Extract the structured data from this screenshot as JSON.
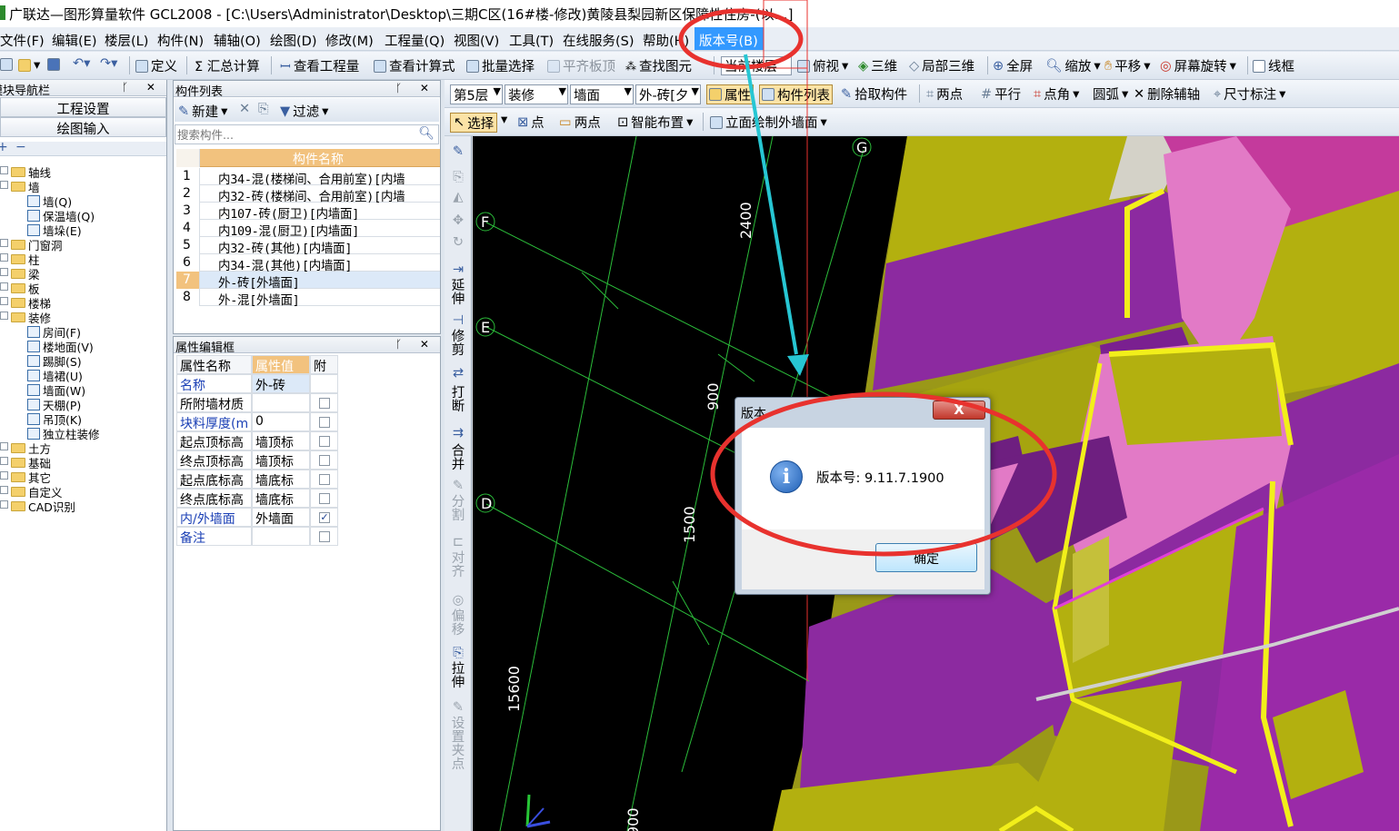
{
  "window": {
    "title": "广联达—图形算量软件 GCL2008 - [C:\\Users\\Administrator\\Desktop\\三期C区(16#楼-修改)黄陵县梨园新区保障性住房-(以…]"
  },
  "menu": {
    "items": [
      "文件(F)",
      "编辑(E)",
      "楼层(L)",
      "构件(N)",
      "辅轴(O)",
      "绘图(D)",
      "修改(M)",
      "工程量(Q)",
      "视图(V)",
      "工具(T)",
      "在线服务(S)",
      "帮助(H)"
    ],
    "version": "版本号(B)"
  },
  "toolbar1": {
    "define": "定义",
    "summary": "Σ 汇总计算",
    "view_qty": "查看工程量",
    "view_formula": "查看计算式",
    "batch_select": "批量选择",
    "flat_slab": "平齐板顶",
    "find_elem": "查找图元",
    "floor_combo": "当前楼层",
    "top_view": "俯视",
    "three_d": "三维",
    "local_3d": "局部三维",
    "fullscreen": "全屏",
    "zoom": "缩放",
    "pan": "平移",
    "rotate": "屏幕旋转",
    "wireframe": "线框"
  },
  "toolbar2": {
    "floor": "第5层",
    "category": "装修",
    "type": "墙面",
    "component": "外-砖[夕",
    "attr": "属性",
    "comp_list": "构件列表",
    "pick": "拾取构件",
    "two_pts": "两点",
    "parallel": "平行",
    "pt_angle": "点角",
    "arc": "圆弧",
    "del_axis": "删除辅轴",
    "dim": "尺寸标注"
  },
  "toolbar3": {
    "select": "选择",
    "point": "点",
    "two_points": "两点",
    "smart": "智能布置",
    "elevation": "立面绘制外墙面"
  },
  "nav": {
    "title": "模块导航栏",
    "project_settings": "工程设置",
    "drawing_input": "绘图输入",
    "tree": [
      {
        "label": "轴线",
        "level": 0
      },
      {
        "label": "墙",
        "level": 0
      },
      {
        "label": "墙(Q)",
        "level": 1
      },
      {
        "label": "保温墙(Q)",
        "level": 1
      },
      {
        "label": "墙垛(E)",
        "level": 1
      },
      {
        "label": "门窗洞",
        "level": 0
      },
      {
        "label": "柱",
        "level": 0
      },
      {
        "label": "梁",
        "level": 0
      },
      {
        "label": "板",
        "level": 0
      },
      {
        "label": "楼梯",
        "level": 0
      },
      {
        "label": "装修",
        "level": 0
      },
      {
        "label": "房间(F)",
        "level": 1
      },
      {
        "label": "楼地面(V)",
        "level": 1
      },
      {
        "label": "踢脚(S)",
        "level": 1
      },
      {
        "label": "墙裙(U)",
        "level": 1
      },
      {
        "label": "墙面(W)",
        "level": 1
      },
      {
        "label": "天棚(P)",
        "level": 1
      },
      {
        "label": "吊顶(K)",
        "level": 1
      },
      {
        "label": "独立柱装修",
        "level": 1
      },
      {
        "label": "土方",
        "level": 0
      },
      {
        "label": "基础",
        "level": 0
      },
      {
        "label": "其它",
        "level": 0
      },
      {
        "label": "自定义",
        "level": 0
      },
      {
        "label": "CAD识别",
        "level": 0
      }
    ]
  },
  "comp_list": {
    "title": "构件列表",
    "new": "新建",
    "filter": "过滤",
    "search_placeholder": "搜索构件...",
    "header": "构件名称",
    "rows": [
      {
        "n": "1",
        "name": "内34-混(楼梯间、合用前室)[内墙"
      },
      {
        "n": "2",
        "name": "内32-砖(楼梯间、合用前室)[内墙"
      },
      {
        "n": "3",
        "name": "内107-砖(厨卫)[内墙面]"
      },
      {
        "n": "4",
        "name": "内109-混(厨卫)[内墙面]"
      },
      {
        "n": "5",
        "name": "内32-砖(其他)[内墙面]"
      },
      {
        "n": "6",
        "name": "内34-混(其他)[内墙面]"
      },
      {
        "n": "7",
        "name": "外-砖[外墙面]"
      },
      {
        "n": "8",
        "name": "外-混[外墙面]"
      }
    ]
  },
  "props": {
    "title": "属性编辑框",
    "col_name": "属性名称",
    "col_value": "属性值",
    "col_extra": "附",
    "rows": [
      {
        "name": "名称",
        "value": "外-砖",
        "check": null,
        "blue": true
      },
      {
        "name": "所附墙材质",
        "value": "",
        "check": false,
        "blue": false
      },
      {
        "name": "块料厚度(m",
        "value": "0",
        "check": false,
        "blue": true
      },
      {
        "name": "起点顶标高",
        "value": "墙顶标",
        "check": false,
        "blue": false
      },
      {
        "name": "终点顶标高",
        "value": "墙顶标",
        "check": false,
        "blue": false
      },
      {
        "name": "起点底标高",
        "value": "墙底标",
        "check": false,
        "blue": false
      },
      {
        "name": "终点底标高",
        "value": "墙底标",
        "check": false,
        "blue": false
      },
      {
        "name": "内/外墙面",
        "value": "外墙面",
        "check": true,
        "blue": true
      },
      {
        "name": "备注",
        "value": "",
        "check": false,
        "blue": true
      }
    ]
  },
  "vtools": [
    "延伸",
    "修剪",
    "打断",
    "合并",
    "分割",
    "对齐",
    "偏移",
    "拉伸",
    "设置夹点"
  ],
  "canvas": {
    "axes": [
      "G",
      "F",
      "E",
      "D"
    ],
    "dims": [
      "2400",
      "900",
      "1500",
      "15600",
      "900"
    ]
  },
  "dialog": {
    "title": "版本",
    "message": "版本号: 9.11.7.1900",
    "ok": "确定",
    "close": "X"
  },
  "colors": {
    "highlight_menu": "#3399ff",
    "annotation_red": "#e8322e",
    "arrow_cyan": "#27c6d3",
    "wall_purple": "#8c2aa0",
    "wall_olive": "#b3b00f",
    "wall_pink": "#e27ac6"
  }
}
